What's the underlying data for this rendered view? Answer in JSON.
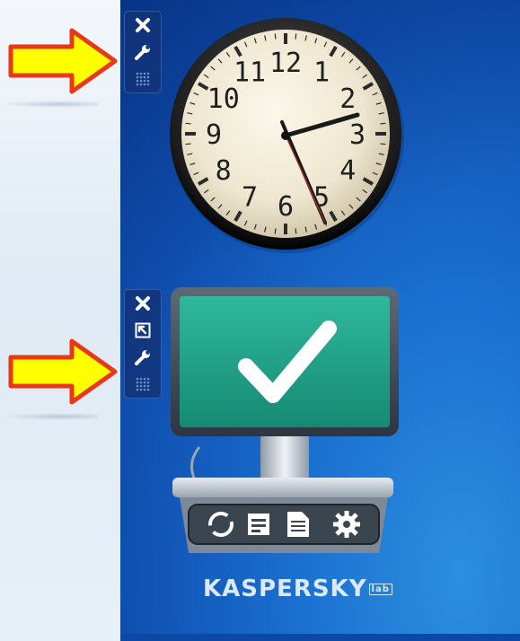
{
  "clock": {
    "numerals": [
      "12",
      "1",
      "2",
      "3",
      "4",
      "5",
      "6",
      "7",
      "8",
      "9",
      "10",
      "11"
    ],
    "time": "2:27"
  },
  "gadget_toolbar_clock": {
    "buttons": [
      "close",
      "options",
      "drag"
    ]
  },
  "gadget_toolbar_kaspersky": {
    "buttons": [
      "close",
      "larger-size",
      "options",
      "drag"
    ]
  },
  "kaspersky": {
    "status": "protected",
    "logo_text": "KASPERSKY",
    "logo_lab": "lab",
    "actions": [
      "update",
      "scan",
      "reports",
      "settings"
    ]
  },
  "colors": {
    "desktop": "#0f4fb0",
    "arrow_fill": "#ffff00",
    "arrow_stroke": "#e8381a",
    "screen": "#1e9d84"
  }
}
